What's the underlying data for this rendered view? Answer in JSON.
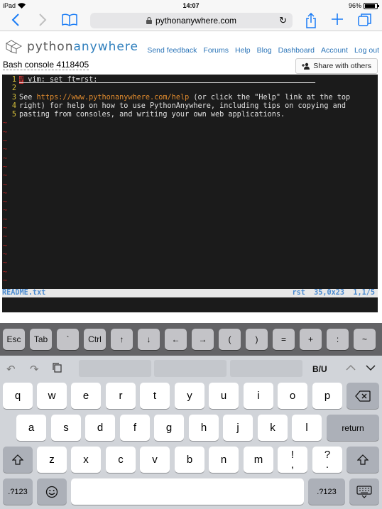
{
  "status_bar": {
    "device": "iPad",
    "time": "14:07",
    "battery": "96%"
  },
  "browser": {
    "url": "pythonanywhere.com"
  },
  "site": {
    "logo_python": "python",
    "logo_anywhere": "anywhere",
    "nav": [
      "Send feedback",
      "Forums",
      "Help",
      "Blog",
      "Dashboard",
      "Account",
      "Log out"
    ],
    "console_title": "Bash console 4118405",
    "share_label": "Share with others"
  },
  "terminal": {
    "line1_hash": "#",
    "line1_rest": " vim: set ft=rst:",
    "line3_pre": "See ",
    "line3_url": "https://www.pythonanywhere.com/help",
    "line3_post": " (or click the \"Help\" link at the top",
    "line4": "right) for help on how to use PythonAnywhere, including tips on copying and",
    "line5": "pasting from consoles, and writing your own web applications.",
    "line_numbers": [
      "1",
      "2",
      "3",
      "4",
      "5"
    ],
    "tilde": "~",
    "status_file": "README.txt",
    "status_right": "rst  35,0x23  1,1/5"
  },
  "shortcut_keys": [
    "Esc",
    "Tab",
    "`",
    "Ctrl",
    "↑",
    "↓",
    "←",
    "→",
    "(",
    ")",
    "=",
    "+",
    ":",
    "~"
  ],
  "keyboard": {
    "format_label": "B/U",
    "row1": [
      "q",
      "w",
      "e",
      "r",
      "t",
      "y",
      "u",
      "i",
      "o",
      "p"
    ],
    "row2": [
      "a",
      "s",
      "d",
      "f",
      "g",
      "h",
      "j",
      "k",
      "l"
    ],
    "return_label": "return",
    "row3": [
      "z",
      "x",
      "c",
      "v",
      "b",
      "n",
      "m"
    ],
    "excl_top": "!",
    "excl_bottom": ",",
    "q_top": "?",
    "q_bottom": ".",
    "numbers_label": ".?123"
  }
}
